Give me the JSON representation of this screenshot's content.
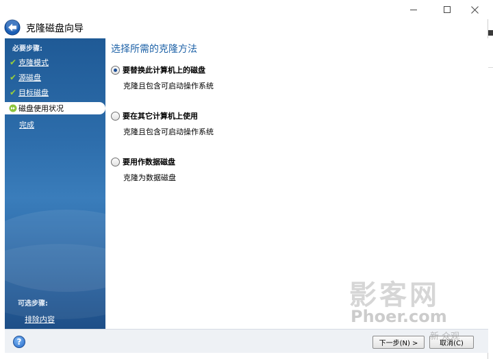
{
  "window": {
    "title": "克隆磁盘向导"
  },
  "sidebar": {
    "required_heading": "必要步骤:",
    "items": [
      {
        "label": "克隆模式",
        "state": "done"
      },
      {
        "label": "源磁盘",
        "state": "done"
      },
      {
        "label": "目标磁盘",
        "state": "done"
      },
      {
        "label": "磁盘使用状况",
        "state": "current"
      },
      {
        "label": "完成",
        "state": "pending"
      }
    ],
    "optional_heading": "可选步骤:",
    "optional_items": [
      {
        "label": "排除内容"
      }
    ]
  },
  "content": {
    "title": "选择所需的克隆方法",
    "options": [
      {
        "label": "要替换此计算机上的磁盘",
        "description": "克隆且包含可启动操作系统",
        "selected": true
      },
      {
        "label": "要在其它计算机上使用",
        "description": "克隆且包含可启动操作系统",
        "selected": false
      },
      {
        "label": "要用作数据磁盘",
        "description": "克隆为数据磁盘",
        "selected": false
      }
    ]
  },
  "footer": {
    "next_label": "下一步(N) >",
    "cancel_label": "取消(C)"
  },
  "watermark": {
    "big": "影客网",
    "small": "Phoer.com",
    "corner": "新 众观"
  },
  "colors": {
    "accent": "#1f63a8",
    "sidebar": "#2d6dab",
    "check": "#9ad03a"
  }
}
